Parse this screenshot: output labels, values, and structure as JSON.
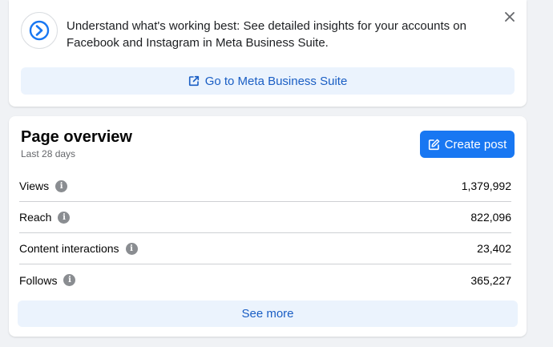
{
  "banner": {
    "message": "Understand what's working best: See detailed insights for your accounts on Facebook and Instagram in Meta Business Suite.",
    "button_label": "Go to Meta Business Suite",
    "logo_icon": "meta-business-suite-icon",
    "close_icon": "close-icon"
  },
  "overview": {
    "title": "Page overview",
    "subtitle": "Last 28 days",
    "create_post_label": "Create post",
    "metrics": [
      {
        "label": "Views",
        "value": "1,379,992"
      },
      {
        "label": "Reach",
        "value": "822,096"
      },
      {
        "label": "Content interactions",
        "value": "23,402"
      },
      {
        "label": "Follows",
        "value": "365,227"
      }
    ],
    "see_more_label": "See more"
  },
  "colors": {
    "primary": "#1877f2",
    "link_blue": "#1a5ec4",
    "light_blue_bg": "#ebf3fd",
    "page_bg": "#f0f2f5"
  }
}
